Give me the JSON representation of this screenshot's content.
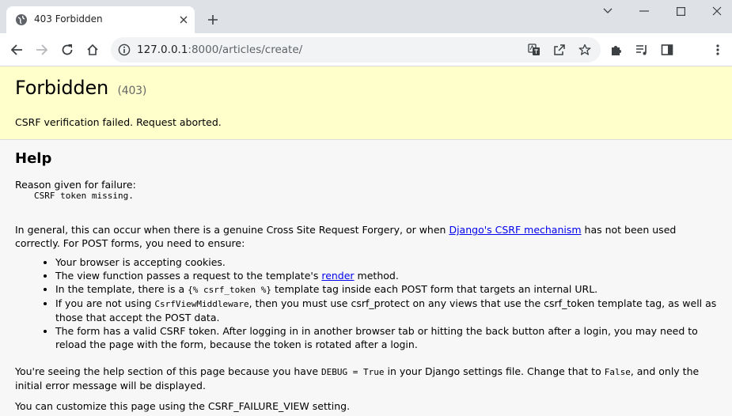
{
  "browser": {
    "tab": {
      "title": "403 Forbidden"
    },
    "url": {
      "host": "127.0.0.1",
      "path": ":8000/articles/create/"
    },
    "icons": {
      "favicon": "globe-icon",
      "back": "back-arrow-icon",
      "forward": "forward-arrow-icon",
      "reload": "reload-icon",
      "home": "home-icon",
      "info": "info-icon",
      "translate": "translate-icon",
      "share": "share-icon",
      "bookmark": "star-icon",
      "extensions": "puzzle-icon",
      "media": "media-queue-icon",
      "sidepanel": "side-panel-icon",
      "menu": "kebab-menu-icon"
    }
  },
  "page": {
    "title": "Forbidden",
    "code": "(403)",
    "summary": "CSRF verification failed. Request aborted.",
    "help_heading": "Help",
    "reason_label": "Reason given for failure:",
    "reason": "CSRF token missing.",
    "general_p1": "In general, this can occur when there is a genuine Cross Site Request Forgery, or when ",
    "general_link": "Django's CSRF mechanism",
    "general_p2": " has not been used correctly. For POST forms, you need to ensure:",
    "checklist": {
      "item1": "Your browser is accepting cookies.",
      "item2_a": "The view function passes a ",
      "item2_code": "request",
      "item2_b": " to the template's ",
      "item2_link": "render",
      "item2_c": " method.",
      "item3_a": "In the template, there is a ",
      "item3_code": "{% csrf_token %}",
      "item3_b": " template tag inside each POST form that targets an internal URL.",
      "item4_a": "If you are not using ",
      "item4_code1": "CsrfViewMiddleware",
      "item4_b": ", then you must use ",
      "item4_code2": "csrf_protect",
      "item4_c": " on any views that use the ",
      "item4_code3": "csrf_token",
      "item4_d": " template tag, as well as those that accept the POST data.",
      "item5": "The form has a valid CSRF token. After logging in in another browser tab or hitting the back button after a login, you may need to reload the page with the form, because the token is rotated after a login."
    },
    "debug_a": "You're seeing the help section of this page because you have ",
    "debug_code1": "DEBUG = True",
    "debug_b": " in your Django settings file. Change that to ",
    "debug_code2": "False",
    "debug_c": ", and only the initial error message will be displayed.",
    "customize": "You can customize this page using the CSRF_FAILURE_VIEW setting."
  }
}
